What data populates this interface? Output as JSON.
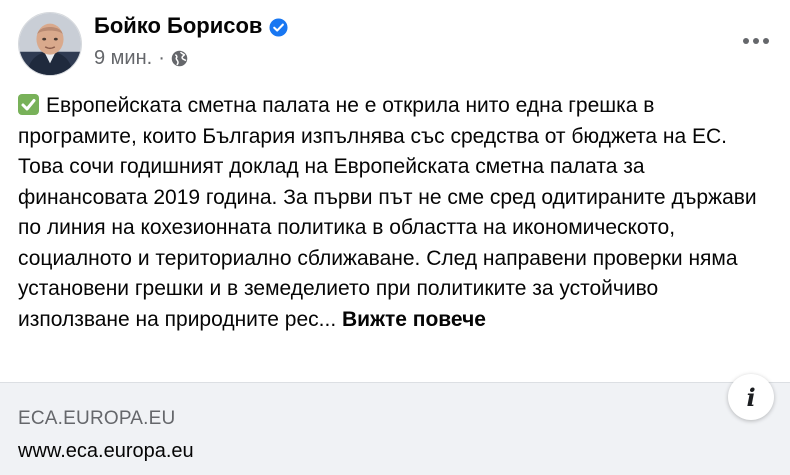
{
  "post": {
    "author": "Бойко Борисов",
    "time": "9 мин.",
    "separator": "·",
    "body": "Европейската сметна палата не е открила нито една грешка в програмите, които България изпълнява със средства от бюджета на ЕС. Това сочи годишният доклад на Европейската сметна палата за финансовата 2019 година. За първи път не сме сред одитираните държави по линия на кохезионната политика в областта на икономическото, социалното и териториално сближаване. След направени проверки няма установени грешки и в земеделието при политиките за устойчиво използване на природните рес...",
    "see_more": "Вижте повече"
  },
  "link": {
    "domain": "ECA.EUROPA.EU",
    "title": "www.eca.europa.eu",
    "info_glyph": "i"
  },
  "colors": {
    "verified_blue": "#1877f2",
    "check_green": "#78b159",
    "secondary_text": "#65676b",
    "card_bg": "#f0f2f5"
  },
  "icons": {
    "verified": "verified-badge-icon",
    "privacy": "globe-icon",
    "more": "more-options-icon",
    "check": "check-mark-emoji-icon",
    "info": "info-icon"
  }
}
